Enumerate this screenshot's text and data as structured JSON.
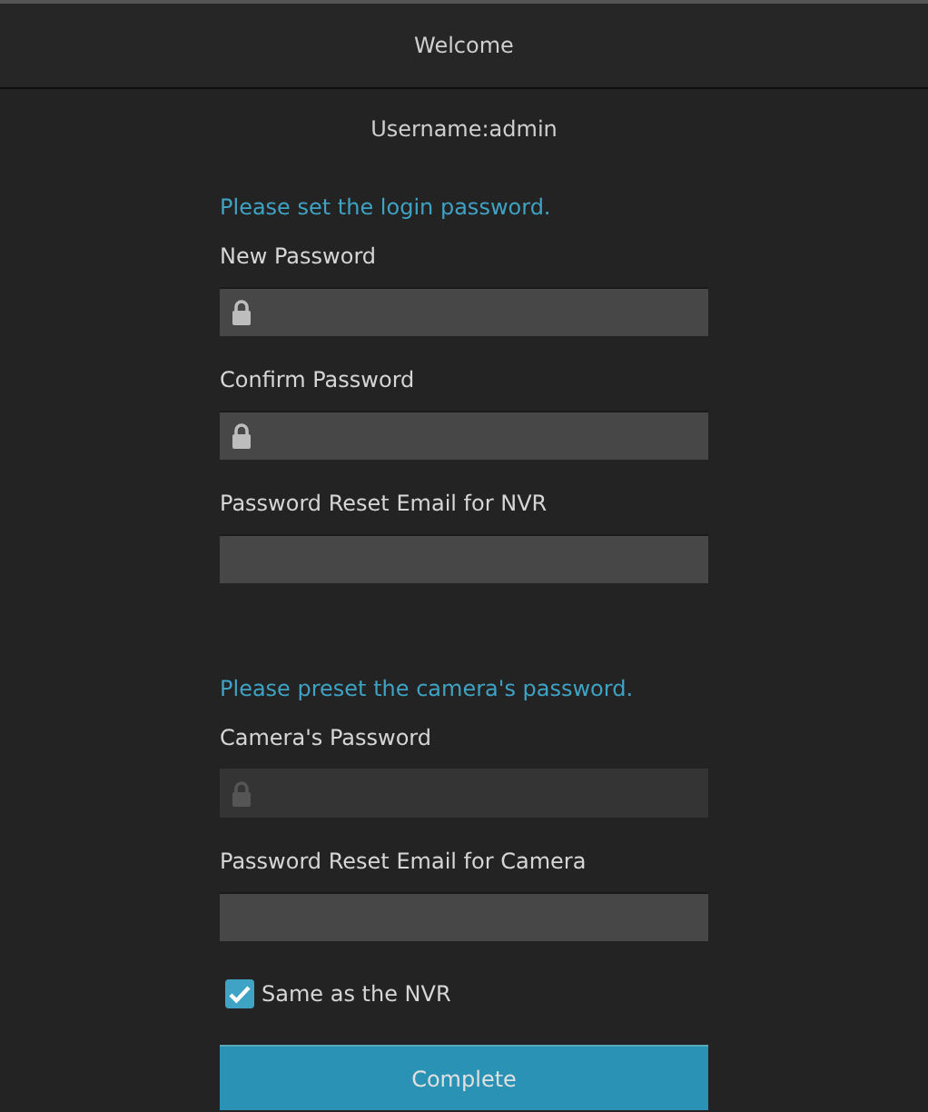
{
  "header": {
    "title": "Welcome"
  },
  "username": "Username:admin",
  "sections": [
    {
      "heading": "Please set the login password.",
      "fields": [
        {
          "label": "New Password",
          "kind": "password",
          "disabled": false
        },
        {
          "label": "Confirm Password",
          "kind": "password",
          "disabled": false
        },
        {
          "label": "Password Reset Email for NVR",
          "kind": "email",
          "disabled": false
        }
      ]
    },
    {
      "heading": "Please preset the camera's password.",
      "fields": [
        {
          "label": "Camera's Password",
          "kind": "password",
          "disabled": true
        },
        {
          "label": "Password Reset Email for Camera",
          "kind": "email",
          "disabled": false
        }
      ]
    }
  ],
  "checkbox": {
    "label": "Same as the NVR",
    "checked": true
  },
  "button": "Complete"
}
